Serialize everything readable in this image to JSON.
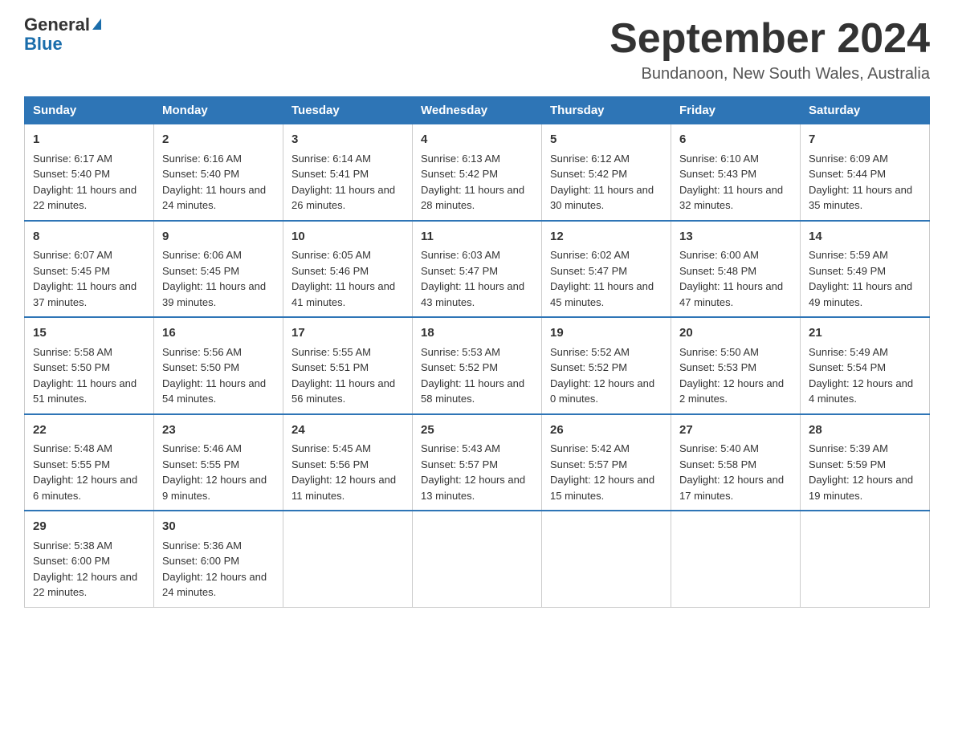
{
  "logo": {
    "general": "General",
    "triangle": "",
    "blue": "Blue"
  },
  "title": {
    "month_year": "September 2024",
    "location": "Bundanoon, New South Wales, Australia"
  },
  "headers": [
    "Sunday",
    "Monday",
    "Tuesday",
    "Wednesday",
    "Thursday",
    "Friday",
    "Saturday"
  ],
  "weeks": [
    [
      {
        "day": "1",
        "sunrise": "6:17 AM",
        "sunset": "5:40 PM",
        "daylight": "11 hours and 22 minutes."
      },
      {
        "day": "2",
        "sunrise": "6:16 AM",
        "sunset": "5:40 PM",
        "daylight": "11 hours and 24 minutes."
      },
      {
        "day": "3",
        "sunrise": "6:14 AM",
        "sunset": "5:41 PM",
        "daylight": "11 hours and 26 minutes."
      },
      {
        "day": "4",
        "sunrise": "6:13 AM",
        "sunset": "5:42 PM",
        "daylight": "11 hours and 28 minutes."
      },
      {
        "day": "5",
        "sunrise": "6:12 AM",
        "sunset": "5:42 PM",
        "daylight": "11 hours and 30 minutes."
      },
      {
        "day": "6",
        "sunrise": "6:10 AM",
        "sunset": "5:43 PM",
        "daylight": "11 hours and 32 minutes."
      },
      {
        "day": "7",
        "sunrise": "6:09 AM",
        "sunset": "5:44 PM",
        "daylight": "11 hours and 35 minutes."
      }
    ],
    [
      {
        "day": "8",
        "sunrise": "6:07 AM",
        "sunset": "5:45 PM",
        "daylight": "11 hours and 37 minutes."
      },
      {
        "day": "9",
        "sunrise": "6:06 AM",
        "sunset": "5:45 PM",
        "daylight": "11 hours and 39 minutes."
      },
      {
        "day": "10",
        "sunrise": "6:05 AM",
        "sunset": "5:46 PM",
        "daylight": "11 hours and 41 minutes."
      },
      {
        "day": "11",
        "sunrise": "6:03 AM",
        "sunset": "5:47 PM",
        "daylight": "11 hours and 43 minutes."
      },
      {
        "day": "12",
        "sunrise": "6:02 AM",
        "sunset": "5:47 PM",
        "daylight": "11 hours and 45 minutes."
      },
      {
        "day": "13",
        "sunrise": "6:00 AM",
        "sunset": "5:48 PM",
        "daylight": "11 hours and 47 minutes."
      },
      {
        "day": "14",
        "sunrise": "5:59 AM",
        "sunset": "5:49 PM",
        "daylight": "11 hours and 49 minutes."
      }
    ],
    [
      {
        "day": "15",
        "sunrise": "5:58 AM",
        "sunset": "5:50 PM",
        "daylight": "11 hours and 51 minutes."
      },
      {
        "day": "16",
        "sunrise": "5:56 AM",
        "sunset": "5:50 PM",
        "daylight": "11 hours and 54 minutes."
      },
      {
        "day": "17",
        "sunrise": "5:55 AM",
        "sunset": "5:51 PM",
        "daylight": "11 hours and 56 minutes."
      },
      {
        "day": "18",
        "sunrise": "5:53 AM",
        "sunset": "5:52 PM",
        "daylight": "11 hours and 58 minutes."
      },
      {
        "day": "19",
        "sunrise": "5:52 AM",
        "sunset": "5:52 PM",
        "daylight": "12 hours and 0 minutes."
      },
      {
        "day": "20",
        "sunrise": "5:50 AM",
        "sunset": "5:53 PM",
        "daylight": "12 hours and 2 minutes."
      },
      {
        "day": "21",
        "sunrise": "5:49 AM",
        "sunset": "5:54 PM",
        "daylight": "12 hours and 4 minutes."
      }
    ],
    [
      {
        "day": "22",
        "sunrise": "5:48 AM",
        "sunset": "5:55 PM",
        "daylight": "12 hours and 6 minutes."
      },
      {
        "day": "23",
        "sunrise": "5:46 AM",
        "sunset": "5:55 PM",
        "daylight": "12 hours and 9 minutes."
      },
      {
        "day": "24",
        "sunrise": "5:45 AM",
        "sunset": "5:56 PM",
        "daylight": "12 hours and 11 minutes."
      },
      {
        "day": "25",
        "sunrise": "5:43 AM",
        "sunset": "5:57 PM",
        "daylight": "12 hours and 13 minutes."
      },
      {
        "day": "26",
        "sunrise": "5:42 AM",
        "sunset": "5:57 PM",
        "daylight": "12 hours and 15 minutes."
      },
      {
        "day": "27",
        "sunrise": "5:40 AM",
        "sunset": "5:58 PM",
        "daylight": "12 hours and 17 minutes."
      },
      {
        "day": "28",
        "sunrise": "5:39 AM",
        "sunset": "5:59 PM",
        "daylight": "12 hours and 19 minutes."
      }
    ],
    [
      {
        "day": "29",
        "sunrise": "5:38 AM",
        "sunset": "6:00 PM",
        "daylight": "12 hours and 22 minutes."
      },
      {
        "day": "30",
        "sunrise": "5:36 AM",
        "sunset": "6:00 PM",
        "daylight": "12 hours and 24 minutes."
      },
      null,
      null,
      null,
      null,
      null
    ]
  ]
}
